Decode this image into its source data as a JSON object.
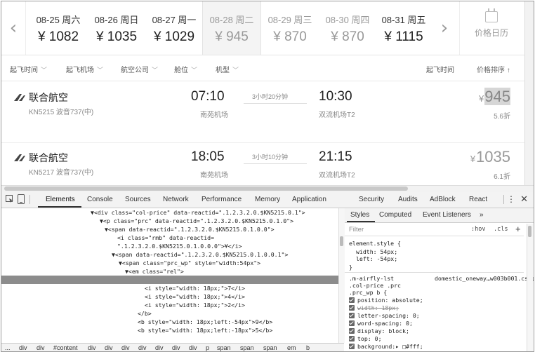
{
  "datebar": {
    "dates": [
      {
        "day": "08-25 周六",
        "price": "¥ 1082",
        "muted": false
      },
      {
        "day": "08-26 周日",
        "price": "¥ 1035",
        "muted": false
      },
      {
        "day": "08-27 周一",
        "price": "¥ 1029",
        "muted": false
      },
      {
        "day": "08-28 周二",
        "price": "¥ 945",
        "muted": true
      },
      {
        "day": "08-29 周三",
        "price": "¥ 870",
        "muted": true
      },
      {
        "day": "08-30 周四",
        "price": "¥ 870",
        "muted": true
      },
      {
        "day": "08-31 周五",
        "price": "¥ 1115",
        "muted": false
      }
    ],
    "prev_icon": "chevron-left-icon",
    "next_icon": "chevron-right-icon",
    "calendar_icon": "calendar-icon",
    "calendar_label": "价格日历"
  },
  "filters": {
    "items": [
      "起飞时间",
      "起飞机场",
      "航空公司",
      "舱位",
      "机型"
    ],
    "sort_depart": "起飞时间",
    "sort_price": "价格排序 ↑"
  },
  "flights": [
    {
      "airline": "联合航空",
      "flight_no": "KN5215 波音737(中)",
      "dep_time": "07:10",
      "dep_airport": "南苑机场",
      "duration": "3小时20分钟",
      "arr_time": "10:30",
      "arr_airport": "双流机场T2",
      "currency": "¥",
      "price": "945",
      "discount": "5.6折"
    },
    {
      "airline": "联合航空",
      "flight_no": "KN5217 波音737(中)",
      "dep_time": "18:05",
      "dep_airport": "南苑机场",
      "duration": "3小时10分钟",
      "arr_time": "21:15",
      "arr_airport": "双流机场T2",
      "currency": "¥",
      "price": "1035",
      "discount": "6.1折"
    }
  ],
  "devtools": {
    "tabs": [
      "Elements",
      "Console",
      "Sources",
      "Network",
      "Performance",
      "Memory",
      "Application",
      "Security",
      "Audits",
      "AdBlock",
      "React"
    ],
    "menu_icon": "more-vertical-icon",
    "close_icon": "close-icon",
    "dom_lines": [
      "▼<div class=\"col-price\" data-reactid=\".1.2.3.2.0.$KN5215.0.1\">",
      "▼<p class=\"prc\" data-reactid=\".1.2.3.2.0.$KN5215.0.1.0\">",
      "▼<span data-reactid=\".1.2.3.2.0.$KN5215.0.1.0.0\">",
      "<i class=\"rmb\" data-reactid=",
      "\".1.2.3.2.0.$KN5215.0.1.0.0.0\">¥</i>",
      "▼<span data-reactid=\".1.2.3.2.0.$KN5215.0.1.0.0.1\">",
      "▼<span class=\"prc_wp\" style=\"width:54px\">",
      "▼<em class=\"rel\">",
      "▼<b style=\"width:54px;left:-54px\"> == $0",
      "<i style=\"width: 18px;\">7</i>",
      "<i style=\"width: 18px;\">4</i>",
      "<i style=\"width: 18px;\">2</i>",
      "</b>",
      "<b style=\"width: 18px;left:-54px\">9</b>",
      "<b style=\"width: 18px;left:-18px\">5</b>"
    ],
    "ellipsis": "...",
    "breadcrumbs": [
      "...",
      "div",
      "div",
      "#content",
      "div",
      "div",
      "div",
      "div",
      "div",
      "div",
      "div",
      "p",
      "span",
      "span",
      "span",
      "em",
      "b"
    ],
    "styles_tabs": [
      "Styles",
      "Computed",
      "Event Listeners",
      "»"
    ],
    "filter_placeholder": "Filter",
    "hov": ":hov",
    "cls": ".cls",
    "plus": "+",
    "element_style": {
      "selector": "element.style {",
      "props": [
        "width: 54px;",
        "left: -54px;"
      ],
      "close": "}"
    },
    "rule": {
      "selector_lines": [
        ".m-airfly-lst",
        ".col-price .prc",
        ".prc_wp b {"
      ],
      "source": "domestic_oneway…w003b001.css:1",
      "props": [
        {
          "text": "position: absolute;",
          "strike": false
        },
        {
          "text": "width: 18px;",
          "strike": true
        },
        {
          "text": "letter-spacing: 0;",
          "strike": false
        },
        {
          "text": "word-spacing: 0;",
          "strike": false
        },
        {
          "text": "display: block;",
          "strike": false
        },
        {
          "text": "top: 0;",
          "strike": false
        },
        {
          "text": "background:▸ □#fff;",
          "strike": false
        }
      ]
    }
  }
}
